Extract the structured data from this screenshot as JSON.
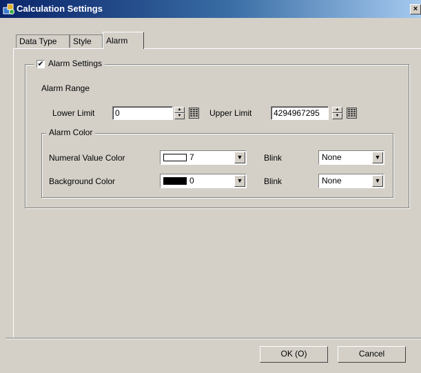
{
  "window": {
    "title": "Calculation Settings",
    "close_glyph": "×"
  },
  "tabs": [
    {
      "label": "Data Type",
      "active": false
    },
    {
      "label": "Style",
      "active": false
    },
    {
      "label": "Alarm",
      "active": true
    }
  ],
  "alarm_settings": {
    "label": "Alarm Settings",
    "checked": true,
    "check_glyph": "✔",
    "range": {
      "heading": "Alarm Range",
      "lower_label": "Lower Limit",
      "lower_value": "0",
      "upper_label": "Upper Limit",
      "upper_value": "4294967295"
    },
    "color": {
      "heading": "Alarm Color",
      "numeral_label": "Numeral Value Color",
      "numeral_value": "7",
      "numeral_swatch": "#ffffff",
      "numeral_blink_label": "Blink",
      "numeral_blink_value": "None",
      "background_label": "Background Color",
      "background_value": "0",
      "background_swatch": "#000000",
      "background_blink_label": "Blink",
      "background_blink_value": "None"
    }
  },
  "buttons": {
    "ok": "OK (O)",
    "cancel": "Cancel"
  },
  "icons": {
    "dropdown": "▼",
    "spin_up": "▲",
    "spin_down": "▼"
  }
}
